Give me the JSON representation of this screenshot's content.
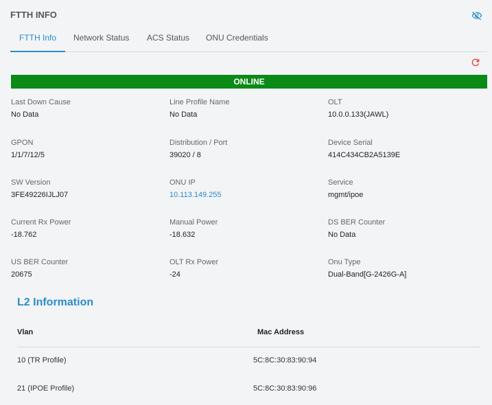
{
  "header": {
    "title": "FTTH INFO",
    "visibility_icon": "eye-off-icon",
    "accent_color": "#2a8bc9"
  },
  "tabs": [
    {
      "label": "FTTH Info",
      "active": true
    },
    {
      "label": "Network Status",
      "active": false
    },
    {
      "label": "ACS Status",
      "active": false
    },
    {
      "label": "ONU Credentials",
      "active": false
    }
  ],
  "refresh_icon": "refresh-icon",
  "status": {
    "text": "ONLINE",
    "color": "#0a8a17"
  },
  "fields": [
    {
      "label": "Last Down Cause",
      "value": "No Data"
    },
    {
      "label": "Line Profile Name",
      "value": "No Data"
    },
    {
      "label": "OLT",
      "value": "10.0.0.133(JAWL)"
    },
    {
      "label": "GPON",
      "value": "1/1/7/12/5"
    },
    {
      "label": "Distribution / Port",
      "value": "39020 / 8"
    },
    {
      "label": "Device Serial",
      "value": "414C434CB2A5139E"
    },
    {
      "label": "SW Version",
      "value": "3FE49226IJLJ07"
    },
    {
      "label": "ONU IP",
      "value": "10.113.149.255"
    },
    {
      "label": "Service",
      "value": "mgmt/ipoe"
    },
    {
      "label": "Current Rx Power",
      "value": "-18.762"
    },
    {
      "label": "Manual Power",
      "value": "-18.632"
    },
    {
      "label": "DS BER Counter",
      "value": "No Data"
    },
    {
      "label": "US BER Counter",
      "value": "20675"
    },
    {
      "label": "OLT Rx Power",
      "value": "-24"
    },
    {
      "label": "Onu Type",
      "value": "Dual-Band[G-2426G-A]"
    }
  ],
  "l2": {
    "title": "L2 Information",
    "columns": [
      "Vlan",
      "Mac Address"
    ],
    "rows": [
      [
        "10 (TR Profile)",
        "5C:8C:30:83:90:94"
      ],
      [
        "21 (IPOE Profile)",
        "5C:8C:30:83:90:96"
      ]
    ]
  }
}
